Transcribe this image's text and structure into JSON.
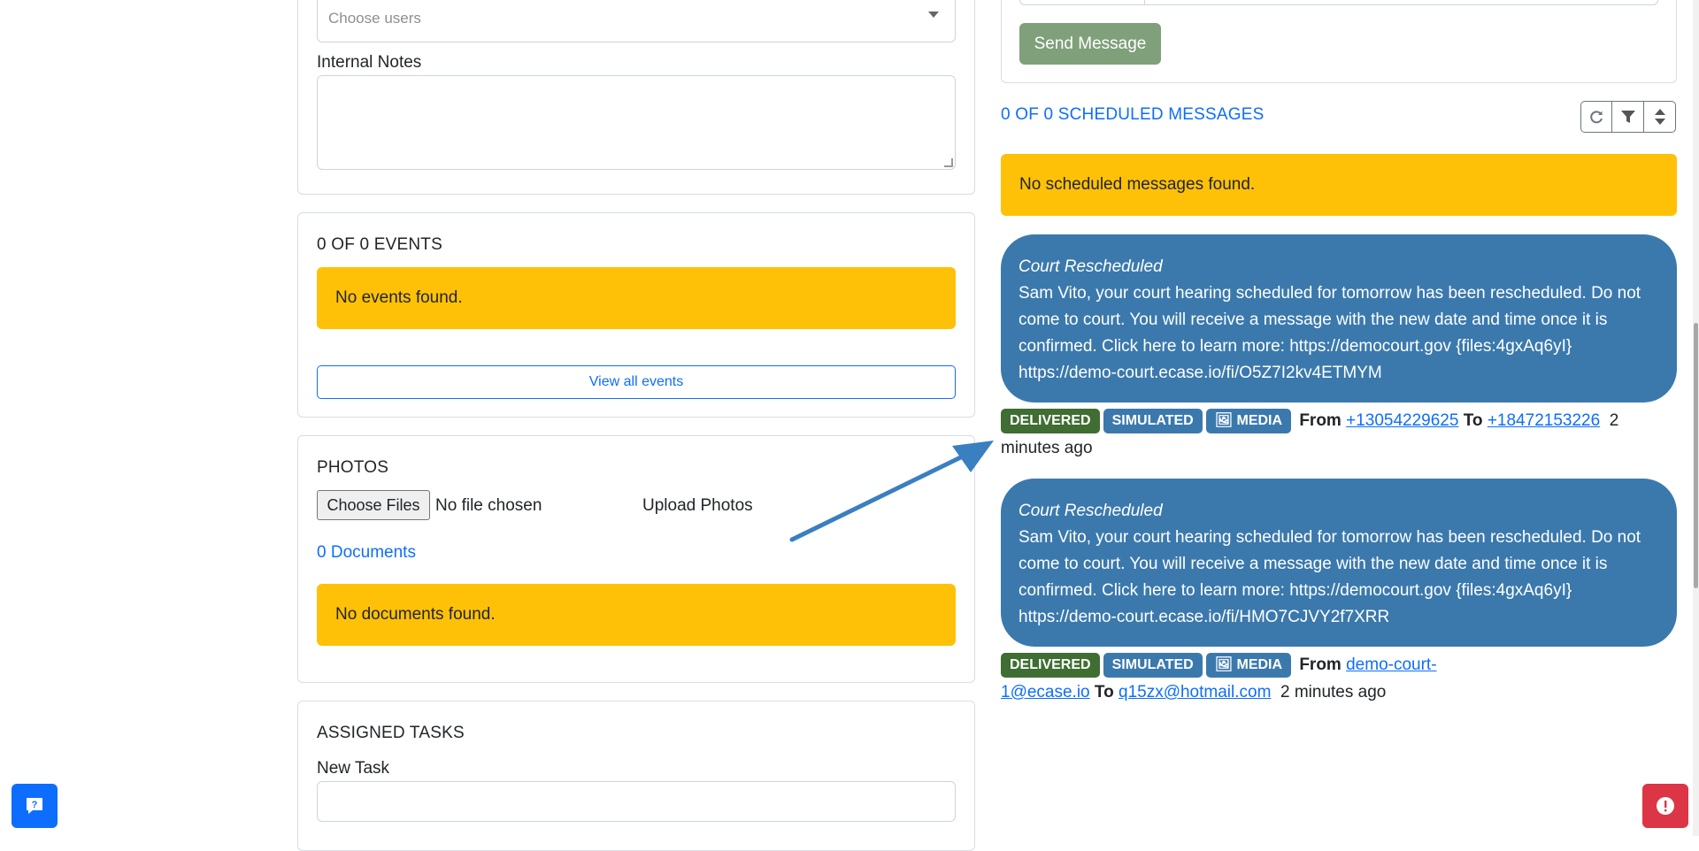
{
  "left": {
    "users_placeholder": "Choose users",
    "internal_notes_label": "Internal Notes",
    "events": {
      "heading": "0 OF 0 EVENTS",
      "empty": "No events found.",
      "view_all": "View all events"
    },
    "photos": {
      "heading": "PHOTOS",
      "choose_files": "Choose Files",
      "no_file": "No file chosen",
      "upload": "Upload Photos",
      "documents_link": "0 Documents",
      "empty": "No documents found."
    },
    "tasks": {
      "heading": "ASSIGNED TASKS",
      "new_task_label": "New Task"
    }
  },
  "right": {
    "send_button": "Send Message",
    "scheduled_heading": "0 OF 0 SCHEDULED MESSAGES",
    "scheduled_empty": "No scheduled messages found.",
    "messages": [
      {
        "title": "Court Rescheduled",
        "body": "Sam Vito, your court hearing scheduled for tomorrow has been rescheduled. Do not come to court. You will receive a message with the new date and time once it is confirmed. Click here to learn more: https://democourt.gov {files:4gxAq6yI} https://demo-court.ecase.io/fi/O5Z7I2kv4ETMYM",
        "status": "DELIVERED",
        "mode": "SIMULATED",
        "media": "MEDIA",
        "from_label": "From",
        "from": "+13054229625",
        "to_label": "To",
        "to": "+18472153226",
        "time": "2 minutes ago"
      },
      {
        "title": "Court Rescheduled",
        "body": "Sam Vito, your court hearing scheduled for tomorrow has been rescheduled. Do not come to court. You will receive a message with the new date and time once it is confirmed. Click here to learn more: https://democourt.gov {files:4gxAq6yI} https://demo-court.ecase.io/fi/HMO7CJVY2f7XRR",
        "status": "DELIVERED",
        "mode": "SIMULATED",
        "media": "MEDIA",
        "from_label": "From",
        "from": "demo-court-1@ecase.io",
        "to_label": "To",
        "to": "q15zx@hotmail.com",
        "time": "2 minutes ago"
      }
    ]
  },
  "icons": {
    "refresh": "refresh-icon",
    "filter": "filter-icon",
    "sort": "sort-icon",
    "help": "help-chat-icon",
    "alert": "alert-icon",
    "arrow": "annotation-arrow"
  },
  "colors": {
    "warning": "#ffc107",
    "bubble": "#3b79ad",
    "delivered": "#3f6d32",
    "link": "#0d6efd",
    "send_button": "#7fa07a",
    "help_button": "#0d6efd",
    "alert_button": "#dc3545"
  }
}
